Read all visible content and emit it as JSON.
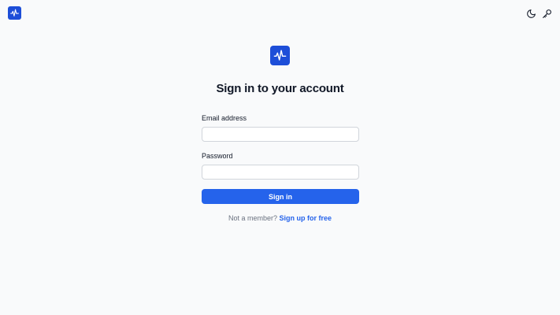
{
  "brand": {
    "logo_icon": "pulse-icon",
    "accent_color": "#1d4ed8",
    "button_color": "#2563eb",
    "link_color": "#2563eb"
  },
  "header": {
    "theme_toggle_icon": "moon-icon",
    "key_icon": "key-icon"
  },
  "main": {
    "title": "Sign in to your account",
    "email": {
      "label": "Email address",
      "value": "",
      "placeholder": ""
    },
    "password": {
      "label": "Password",
      "value": "",
      "placeholder": ""
    },
    "submit_label": "Sign in",
    "footer_text": "Not a member?",
    "footer_link": "Sign up for free"
  }
}
